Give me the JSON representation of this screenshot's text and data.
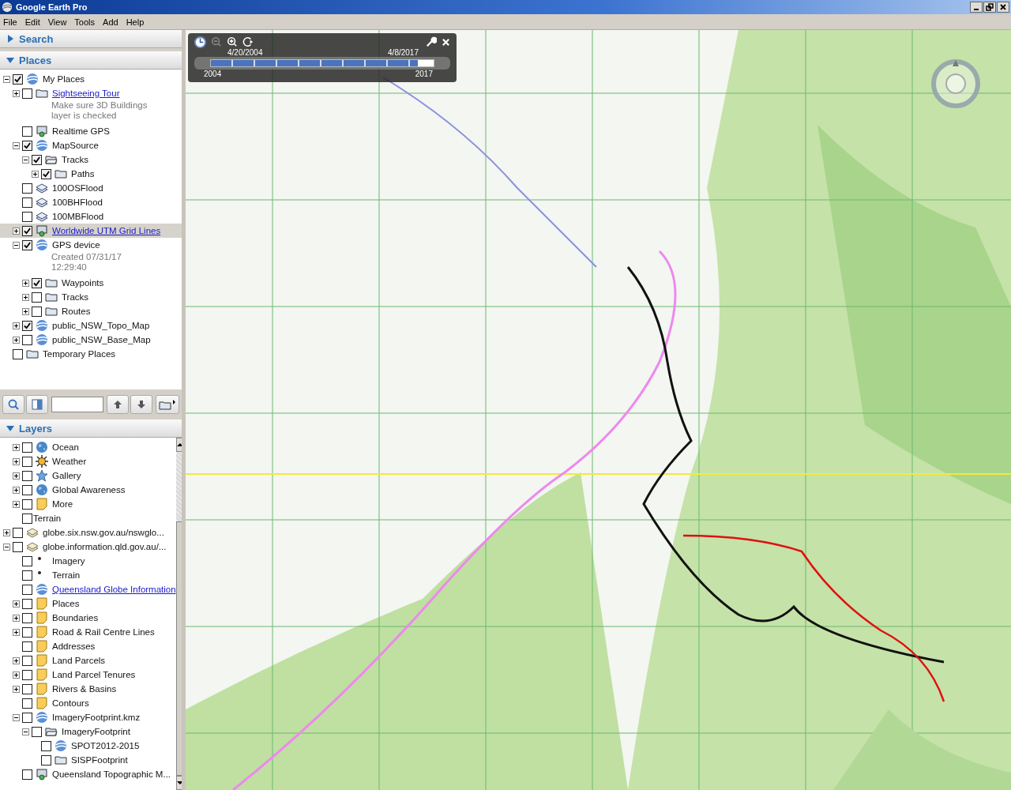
{
  "window": {
    "title": "Google Earth Pro"
  },
  "menu": [
    "File",
    "Edit",
    "View",
    "Tools",
    "Add",
    "Help"
  ],
  "search": {
    "header": "Search",
    "expanded": false
  },
  "places": {
    "header": "Places",
    "expanded": true,
    "tree": [
      {
        "label": "My Places",
        "kind": "kml",
        "checked": true,
        "expanded": true,
        "selected": false,
        "children": [
          {
            "label": "Sightseeing Tour",
            "kind": "folder",
            "checked": false,
            "expanded": false,
            "link": true,
            "selected": false,
            "note": "Make sure 3D Buildings layer is checked"
          },
          {
            "label": "Realtime GPS",
            "kind": "network",
            "checked": false,
            "selected": false
          },
          {
            "label": "MapSource",
            "kind": "kml",
            "checked": true,
            "expanded": true,
            "selected": false,
            "children": [
              {
                "label": "Tracks",
                "kind": "folder-open",
                "checked": true,
                "expanded": true,
                "selected": false,
                "children": [
                  {
                    "label": "Paths",
                    "kind": "folder",
                    "checked": true,
                    "expanded": false,
                    "selected": false
                  }
                ]
              }
            ]
          },
          {
            "label": "100OSFlood",
            "kind": "overlay",
            "checked": false,
            "selected": false
          },
          {
            "label": "100BHFlood",
            "kind": "overlay",
            "checked": false,
            "selected": false
          },
          {
            "label": "100MBFlood",
            "kind": "overlay",
            "checked": false,
            "selected": false
          },
          {
            "label": "Worldwide UTM Grid Lines",
            "kind": "network",
            "checked": true,
            "expanded": false,
            "link": true,
            "selected": true
          },
          {
            "label": "GPS device",
            "kind": "kml",
            "checked": true,
            "expanded": true,
            "selected": false,
            "note": "Created 07/31/17 12:29:40",
            "children": [
              {
                "label": "Waypoints",
                "kind": "folder",
                "checked": true,
                "expanded": false,
                "selected": false
              },
              {
                "label": "Tracks",
                "kind": "folder",
                "checked": false,
                "expanded": false,
                "selected": false
              },
              {
                "label": "Routes",
                "kind": "folder",
                "checked": false,
                "expanded": false,
                "selected": false
              }
            ]
          },
          {
            "label": "public_NSW_Topo_Map",
            "kind": "kml",
            "checked": true,
            "expanded": false,
            "selected": false
          },
          {
            "label": "public_NSW_Base_Map",
            "kind": "kml",
            "checked": false,
            "expanded": false,
            "selected": false
          }
        ]
      },
      {
        "label": "Temporary Places",
        "kind": "folder",
        "checked": false,
        "selected": false
      }
    ]
  },
  "layers": {
    "header": "Layers",
    "expanded": true,
    "continued": [
      {
        "label": "Ocean",
        "kind": "earth",
        "checked": false,
        "expanded": false
      },
      {
        "label": "Weather",
        "kind": "sun",
        "checked": false,
        "expanded": false
      },
      {
        "label": "Gallery",
        "kind": "star",
        "checked": false,
        "expanded": false
      },
      {
        "label": "Global Awareness",
        "kind": "earth",
        "checked": false,
        "expanded": false
      },
      {
        "label": "More",
        "kind": "note",
        "checked": false,
        "expanded": false
      },
      {
        "label": "Terrain",
        "kind": "plain",
        "checked": false
      }
    ],
    "tree": [
      {
        "label": "globe.six.nsw.gov.au/nswglo...",
        "kind": "layers",
        "checked": false,
        "expanded": false
      },
      {
        "label": "globe.information.qld.gov.au/...",
        "kind": "layers",
        "checked": false,
        "expanded": true,
        "children": [
          {
            "label": "Imagery",
            "kind": "dot",
            "checked": false
          },
          {
            "label": "Terrain",
            "kind": "dot",
            "checked": false
          },
          {
            "label": "Queensland Globe Information",
            "kind": "kml",
            "checked": false,
            "link": true
          },
          {
            "label": "Places",
            "kind": "note",
            "checked": false,
            "expanded": false
          },
          {
            "label": "Boundaries",
            "kind": "note",
            "checked": false,
            "expanded": false
          },
          {
            "label": "Road & Rail Centre Lines",
            "kind": "note",
            "checked": false,
            "expanded": false
          },
          {
            "label": "Addresses",
            "kind": "note",
            "checked": false
          },
          {
            "label": "Land Parcels",
            "kind": "note",
            "checked": false,
            "expanded": false
          },
          {
            "label": "Land Parcel Tenures",
            "kind": "note",
            "checked": false,
            "expanded": false
          },
          {
            "label": "Rivers & Basins",
            "kind": "note",
            "checked": false,
            "expanded": false
          },
          {
            "label": "Contours",
            "kind": "note",
            "checked": false
          },
          {
            "label": "ImageryFootprint.kmz",
            "kind": "kml",
            "checked": false,
            "expanded": true,
            "children": [
              {
                "label": "ImageryFootprint",
                "kind": "folder-open",
                "checked": false,
                "expanded": true,
                "children": [
                  {
                    "label": "SPOT2012-2015",
                    "kind": "kml",
                    "checked": false
                  },
                  {
                    "label": "SISPFootprint",
                    "kind": "folder",
                    "checked": false
                  }
                ]
              }
            ]
          },
          {
            "label": "Queensland Topographic M...",
            "kind": "network",
            "checked": false
          }
        ]
      }
    ]
  },
  "time_slider": {
    "start_date": "4/20/2004",
    "end_date": "4/8/2017",
    "start_year": "2004",
    "end_year": "2017",
    "level": 0.93
  }
}
